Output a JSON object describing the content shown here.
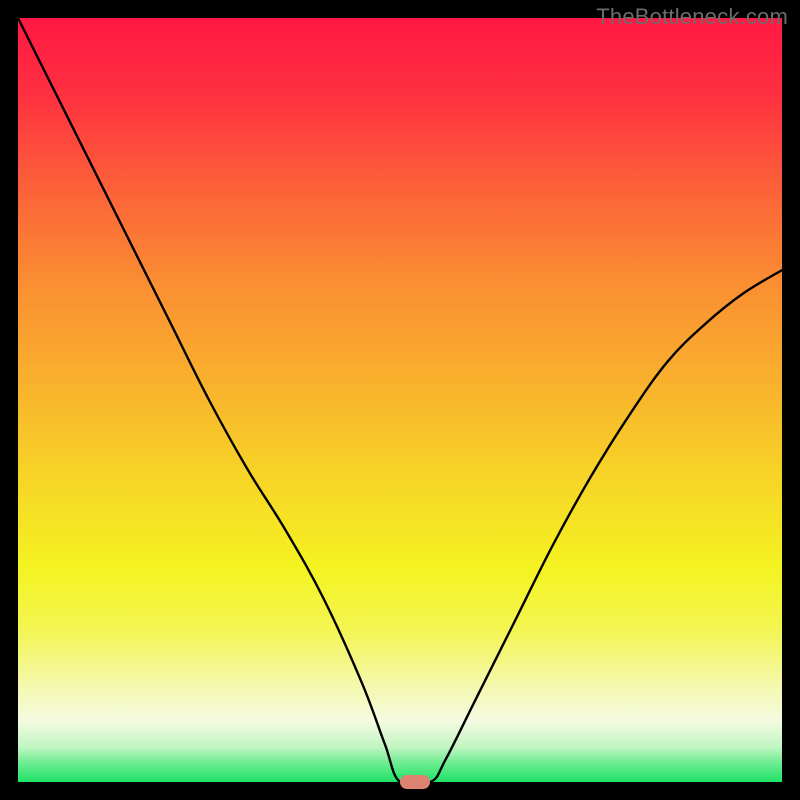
{
  "watermark": "TheBottleneck.com",
  "colors": {
    "black": "#000000",
    "curve": "#000000",
    "marker": "#de8272",
    "gradient": [
      {
        "offset": 0.0,
        "color": "#ff1843"
      },
      {
        "offset": 0.1,
        "color": "#fe3040"
      },
      {
        "offset": 0.22,
        "color": "#fc6039"
      },
      {
        "offset": 0.35,
        "color": "#fa8f32"
      },
      {
        "offset": 0.48,
        "color": "#f9b22d"
      },
      {
        "offset": 0.6,
        "color": "#f7d427"
      },
      {
        "offset": 0.72,
        "color": "#f4f321"
      },
      {
        "offset": 0.8,
        "color": "#f4f552"
      },
      {
        "offset": 0.87,
        "color": "#f4f8a8"
      },
      {
        "offset": 0.92,
        "color": "#f5fbe2"
      },
      {
        "offset": 0.955,
        "color": "#bff5c0"
      },
      {
        "offset": 0.975,
        "color": "#6eec92"
      },
      {
        "offset": 1.0,
        "color": "#1ee366"
      }
    ]
  },
  "plot": {
    "inner_w": 764,
    "inner_h": 764,
    "border_px": 18
  },
  "chart_data": {
    "type": "line",
    "title": "",
    "xlabel": "",
    "ylabel": "",
    "xlim": [
      0,
      100
    ],
    "ylim": [
      0,
      100
    ],
    "grid": false,
    "series": [
      {
        "name": "curve",
        "x": [
          0,
          5,
          10,
          15,
          20,
          25,
          30,
          35,
          40,
          45,
          48,
          50,
          54,
          56,
          60,
          65,
          70,
          75,
          80,
          85,
          90,
          95,
          100
        ],
        "y": [
          100,
          90,
          80,
          70,
          60,
          50,
          41,
          33,
          24,
          13,
          5,
          0,
          0,
          3,
          11,
          21,
          31,
          40,
          48,
          55,
          60,
          64,
          67
        ]
      }
    ],
    "annotations": [
      {
        "type": "marker",
        "shape": "pill",
        "x": 52,
        "y": 0,
        "color": "#de8272"
      }
    ]
  }
}
